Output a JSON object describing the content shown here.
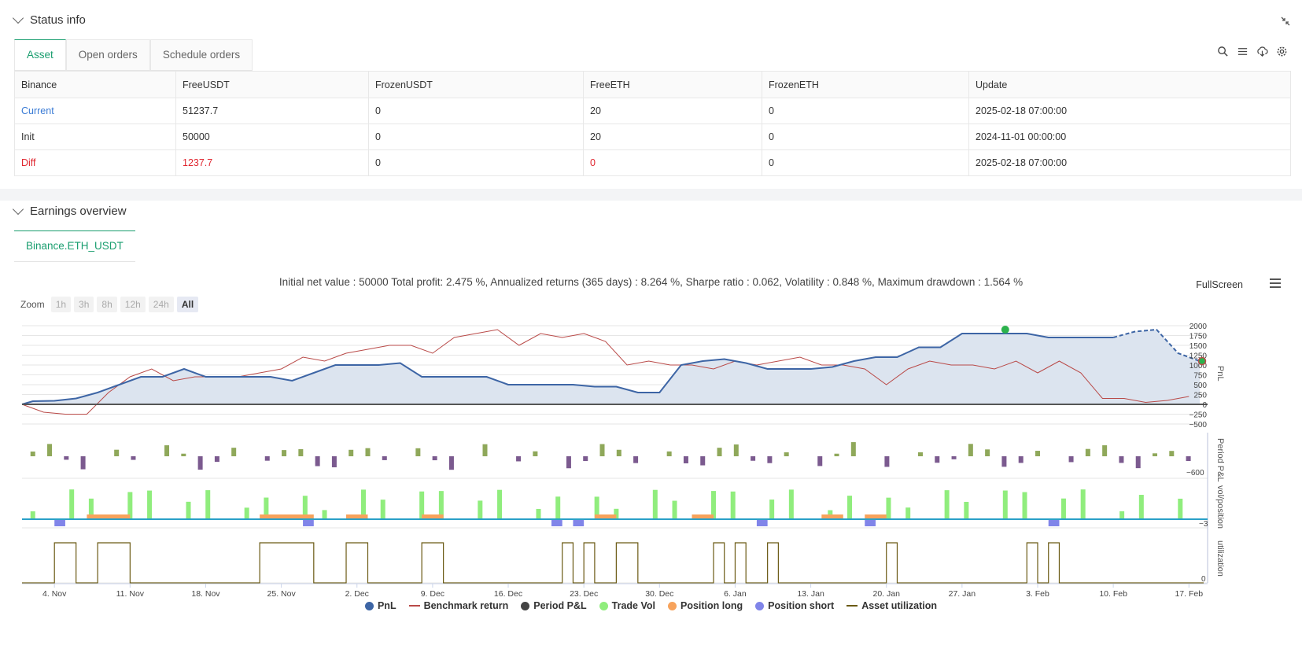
{
  "status": {
    "title": "Status info",
    "tabs": [
      "Asset",
      "Open orders",
      "Schedule orders"
    ],
    "columns": [
      "Binance",
      "FreeUSDT",
      "FrozenUSDT",
      "FreeETH",
      "FrozenETH",
      "Update"
    ],
    "rows": [
      [
        "Current",
        "51237.7",
        "0",
        "20",
        "0",
        "2025-02-18 07:00:00"
      ],
      [
        "Init",
        "50000",
        "0",
        "20",
        "0",
        "2024-11-01 00:00:00"
      ],
      [
        "Diff",
        "1237.7",
        "0",
        "0",
        "0",
        "2025-02-18 07:00:00"
      ]
    ]
  },
  "earnings": {
    "title": "Earnings overview",
    "tab": "Binance.ETH_USDT",
    "summary": "Initial net value : 50000 Total profit: 2.475 %, Annualized returns (365 days) : 8.264 %, Sharpe ratio : 0.062, Volatility : 0.848 %, Maximum drawdown : 1.564 %",
    "fullscreen": "FullScreen",
    "zoom_label": "Zoom",
    "zoom_buttons": [
      "1h",
      "3h",
      "8h",
      "12h",
      "24h",
      "All"
    ],
    "legend": [
      "PnL",
      "Benchmark return",
      "Period P&L",
      "Trade Vol",
      "Position long",
      "Position short",
      "Asset utilization"
    ]
  },
  "colors": {
    "pnl": "#3d65a5",
    "benchmark": "#b94a48",
    "period": "#444444",
    "tradevol": "#90ed7d",
    "poslong": "#f7a35c",
    "posshort": "#8085e9",
    "util": "#6b5a14",
    "accent": "#1a9e6f"
  },
  "chart_data": {
    "type": "line",
    "x_ticks": [
      "4. Nov",
      "11. Nov",
      "18. Nov",
      "25. Nov",
      "2. Dec",
      "9. Dec",
      "16. Dec",
      "23. Dec",
      "30. Dec",
      "6. Jan",
      "13. Jan",
      "20. Jan",
      "27. Jan",
      "3. Feb",
      "10. Feb",
      "17. Feb"
    ],
    "y_ticks": [
      "2000",
      "1750",
      "1500",
      "1250",
      "1000",
      "750",
      "500",
      "250",
      "0",
      "−250",
      "−500"
    ],
    "ylim": [
      -500,
      2000
    ],
    "axis_labels": [
      "PnL",
      "Period P&L",
      "vol/position",
      "utilization"
    ],
    "period_min_label": "−600",
    "vol_min_label": "−3",
    "util_min_label": "0",
    "series": [
      {
        "name": "PnL",
        "x_days": [
          0,
          1,
          3,
          5,
          7,
          9,
          11,
          13,
          15,
          17,
          19,
          21,
          23,
          25,
          27,
          29,
          31,
          33,
          35,
          37,
          39,
          41,
          43,
          45,
          47,
          49,
          51,
          53,
          55,
          57,
          59,
          61,
          63,
          65,
          67,
          69,
          71,
          73,
          75,
          77,
          79,
          81,
          83,
          85,
          87,
          89,
          91,
          93,
          95,
          97,
          99,
          101,
          103,
          105,
          107,
          109
        ],
        "values": [
          0,
          80,
          90,
          150,
          300,
          500,
          700,
          700,
          900,
          700,
          700,
          700,
          700,
          600,
          800,
          1000,
          1000,
          1000,
          1050,
          700,
          700,
          700,
          700,
          500,
          500,
          500,
          500,
          450,
          450,
          300,
          300,
          1000,
          1100,
          1150,
          1050,
          900,
          900,
          900,
          950,
          1100,
          1200,
          1200,
          1450,
          1450,
          1800,
          1800,
          1800,
          1800,
          1700,
          1700,
          1700,
          1700,
          1850,
          1900,
          1300,
          1100
        ]
      },
      {
        "name": "Benchmark return",
        "x_days": [
          0,
          2,
          4,
          6,
          8,
          10,
          12,
          14,
          16,
          18,
          20,
          22,
          24,
          26,
          28,
          30,
          32,
          34,
          36,
          38,
          40,
          42,
          44,
          46,
          48,
          50,
          52,
          54,
          56,
          58,
          60,
          62,
          64,
          66,
          68,
          70,
          72,
          74,
          76,
          78,
          80,
          82,
          84,
          86,
          88,
          90,
          92,
          94,
          96,
          98,
          100,
          102,
          104,
          106,
          108
        ],
        "values": [
          0,
          -200,
          -250,
          -250,
          300,
          700,
          900,
          600,
          700,
          700,
          700,
          800,
          900,
          1200,
          1100,
          1300,
          1400,
          1500,
          1500,
          1300,
          1700,
          1800,
          1900,
          1500,
          1800,
          1700,
          1800,
          1600,
          1000,
          1100,
          1000,
          1000,
          900,
          1100,
          1000,
          1100,
          1200,
          1000,
          1000,
          900,
          500,
          900,
          1100,
          1000,
          1000,
          900,
          1100,
          800,
          1100,
          800,
          150,
          150,
          50,
          100,
          200
        ]
      }
    ]
  }
}
